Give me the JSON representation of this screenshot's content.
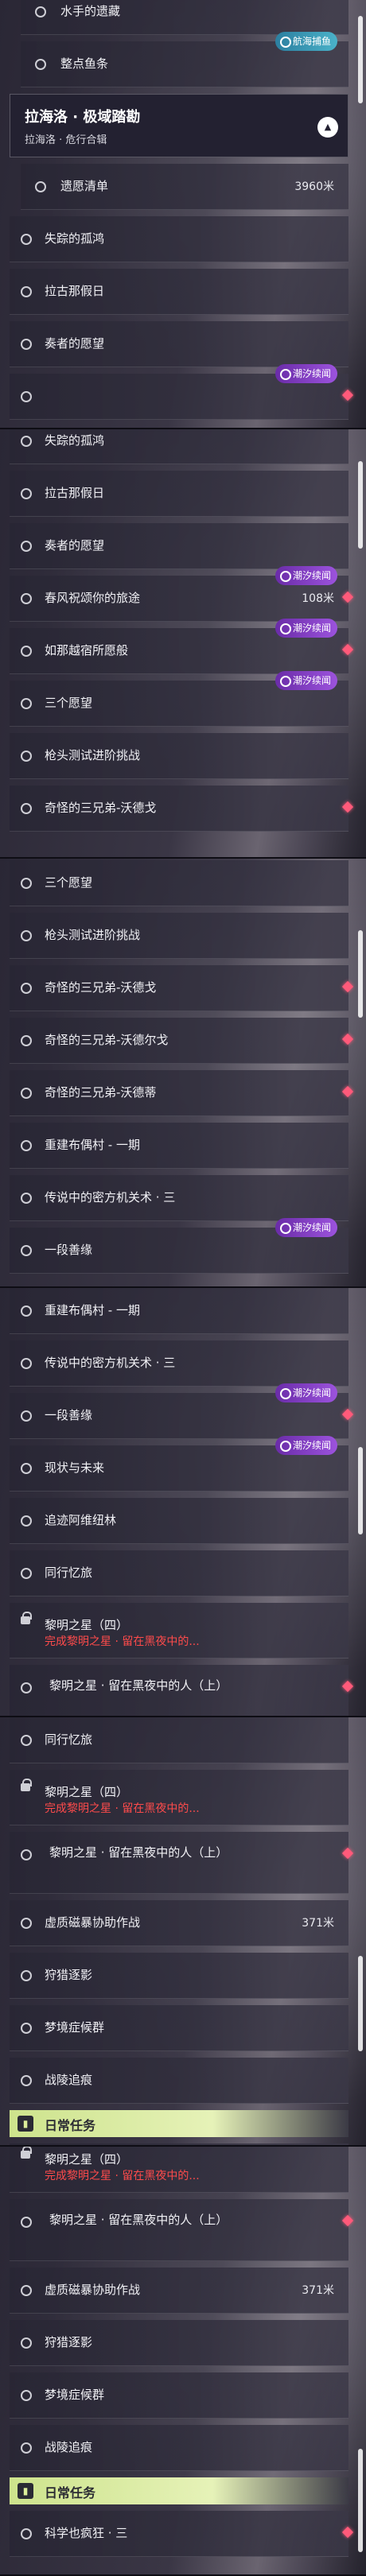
{
  "tags": {
    "sea": "航海捕鱼",
    "tide": "潮汐续闻"
  },
  "header": {
    "title": "拉海洛 · 极域踏勘",
    "subtitle": "拉海洛 · 危行合辑"
  },
  "section": {
    "title": "日常任务"
  },
  "frames": [
    {
      "rows": [
        {
          "kind": "radio",
          "inner": true,
          "title": "水手的遗藏",
          "tag": "sea"
        },
        {
          "kind": "radio",
          "inner": true,
          "title": "整点鱼条",
          "tag": "sea"
        },
        {
          "kind": "header"
        },
        {
          "kind": "radio",
          "inner": true,
          "title": "遗愿清单",
          "dist": "3960米"
        },
        {
          "kind": "radio",
          "title": "失踪的孤鸿"
        },
        {
          "kind": "radio",
          "title": "拉古那假日"
        },
        {
          "kind": "radio",
          "title": "奏者的愿望"
        },
        {
          "kind": "radio",
          "title": "",
          "tag": "tide",
          "diamond": true
        }
      ]
    },
    {
      "rows": [
        {
          "kind": "radio",
          "title": "失踪的孤鸿"
        },
        {
          "kind": "radio",
          "title": "拉古那假日"
        },
        {
          "kind": "radio",
          "title": "奏者的愿望"
        },
        {
          "kind": "radio",
          "title": "春风祝颂你的旅途",
          "dist": "108米",
          "tag": "tide",
          "diamond": true
        },
        {
          "kind": "radio",
          "title": "如那越宿所愿般",
          "tag": "tide",
          "diamond": true
        },
        {
          "kind": "radio",
          "title": "三个愿望",
          "tag": "tide"
        },
        {
          "kind": "radio",
          "title": "枪头测试进阶挑战"
        },
        {
          "kind": "radio",
          "title": "奇怪的三兄弟-沃德戈",
          "diamond": true
        }
      ]
    },
    {
      "rows": [
        {
          "kind": "radio",
          "title": "三个愿望"
        },
        {
          "kind": "radio",
          "title": "枪头测试进阶挑战"
        },
        {
          "kind": "radio",
          "title": "奇怪的三兄弟-沃德戈",
          "diamond": true
        },
        {
          "kind": "radio",
          "title": "奇怪的三兄弟-沃德尔戈",
          "diamond": true
        },
        {
          "kind": "radio",
          "title": "奇怪的三兄弟-沃德蒂",
          "diamond": true
        },
        {
          "kind": "radio",
          "title": "重建布偶村 - 一期"
        },
        {
          "kind": "radio",
          "title": "传说中的密方机关术 · 三"
        },
        {
          "kind": "radio",
          "title": "一段善缘",
          "tag": "tide"
        }
      ]
    },
    {
      "rows": [
        {
          "kind": "radio",
          "title": "重建布偶村 - 一期"
        },
        {
          "kind": "radio",
          "title": "传说中的密方机关术 · 三"
        },
        {
          "kind": "radio",
          "title": "一段善缘",
          "tag": "tide",
          "diamond": true
        },
        {
          "kind": "radio",
          "title": "现状与未来",
          "tag": "tide"
        },
        {
          "kind": "radio",
          "title": "追迹阿维纽林"
        },
        {
          "kind": "radio",
          "title": "同行忆旅"
        },
        {
          "kind": "lock",
          "title": "黎明之星（四）",
          "sub": "完成黎明之星 · 留在黑夜中的..."
        },
        {
          "kind": "tall",
          "title": "黎明之星 · 留在黑夜中的人（上）",
          "diamond": true
        }
      ]
    },
    {
      "rows": [
        {
          "kind": "radio",
          "title": "同行忆旅"
        },
        {
          "kind": "lock",
          "title": "黎明之星（四）",
          "sub": "完成黎明之星 · 留在黑夜中的..."
        },
        {
          "kind": "tall",
          "title": "黎明之星 · 留在黑夜中的人（上）",
          "diamond": true
        },
        {
          "kind": "radio",
          "title": "虚质磁暴协助作战",
          "dist": "371米"
        },
        {
          "kind": "radio",
          "title": "狩猎逐影"
        },
        {
          "kind": "radio",
          "title": "梦境症候群"
        },
        {
          "kind": "radio",
          "title": "战陵追痕"
        },
        {
          "kind": "section"
        },
        {
          "kind": "radio",
          "title": "科学也疯狂 · 三",
          "diamond": true
        }
      ]
    },
    {
      "rows": [
        {
          "kind": "lock",
          "title": "黎明之星（四）",
          "sub": "完成黎明之星 · 留在黑夜中的..."
        },
        {
          "kind": "tall",
          "title": "黎明之星 · 留在黑夜中的人（上）",
          "diamond": true
        },
        {
          "kind": "radio",
          "title": "虚质磁暴协助作战",
          "dist": "371米"
        },
        {
          "kind": "radio",
          "title": "狩猎逐影"
        },
        {
          "kind": "radio",
          "title": "梦境症候群"
        },
        {
          "kind": "radio",
          "title": "战陵追痕"
        },
        {
          "kind": "section"
        },
        {
          "kind": "radio",
          "title": "科学也疯狂 · 三",
          "diamond": true
        }
      ]
    }
  ]
}
